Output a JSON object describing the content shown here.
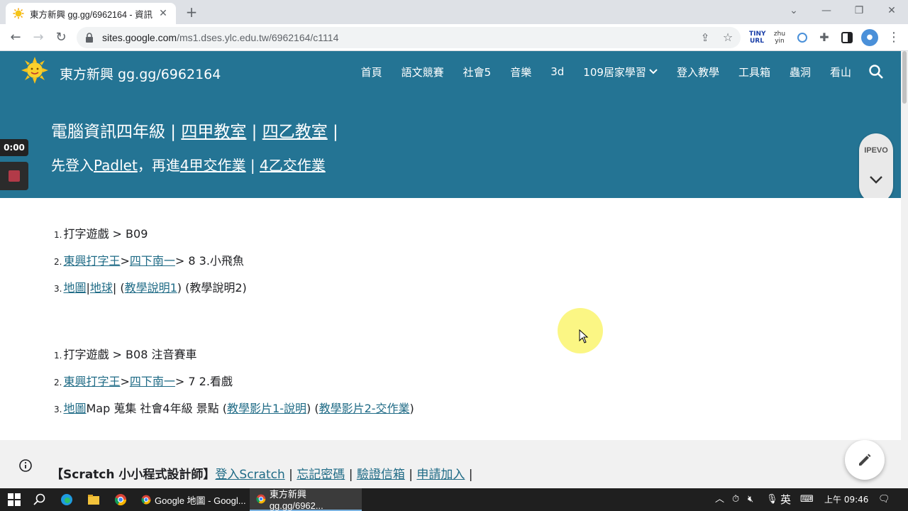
{
  "browser": {
    "tab_title": "東方新興 gg.gg/6962164 - 資訊",
    "url_host": "sites.google.com",
    "url_path": "/ms1.dses.ylc.edu.tw/6962164/c1114",
    "ext_tinyurl": "TINY URL",
    "ext_zhuyin": "zhu yin"
  },
  "site": {
    "title": "東方新興 gg.gg/6962164",
    "nav": [
      {
        "label": "首頁"
      },
      {
        "label": "語文競賽"
      },
      {
        "label": "社會5"
      },
      {
        "label": "音樂"
      },
      {
        "label": "3d"
      },
      {
        "label": "109居家學習"
      },
      {
        "label": "登入教學"
      },
      {
        "label": "工具箱"
      },
      {
        "label": "蟲洞"
      },
      {
        "label": "看山"
      }
    ]
  },
  "hero": {
    "line1_prefix": "電腦資訊四年級 | ",
    "link_class_a": "四甲教室",
    "sep1": " | ",
    "link_class_b": "四乙教室",
    "sep2": " |",
    "line2_prefix": "先登入",
    "link_padlet": "Padlet",
    "line2_mid": "，再進",
    "link_hw_a": "4甲交作業",
    "sep3": " | ",
    "link_hw_b": "4乙交作業"
  },
  "recorder": {
    "time": "0:00"
  },
  "ipevo": {
    "label": "IPEVO"
  },
  "list1": {
    "item1_num": "1.",
    "item1_text": "打字遊戲 > B09",
    "item2_num": "2.",
    "item2_link1": " 東興打字王 ",
    "item2_sep": "> ",
    "item2_link2": "四下南一",
    "item2_text": "  > 8 3.小飛魚",
    "item3_num": "3.",
    "item3_link1": "地圖 ",
    "item3_sep1": " | ",
    "item3_link2": "地球",
    "item3_sep2": " | (",
    "item3_link3": "教學說明1",
    "item3_text": " ) (教學說明2)"
  },
  "list2": {
    "item1_num": "1.",
    "item1_text": "打字遊戲 > B08 注音賽車",
    "item2_num": "2.",
    "item2_link1": " 東興打字王 ",
    "item2_sep": "> ",
    "item2_link2": "四下南一",
    "item2_text": "  > 7 2.看戲",
    "item3_num": "3.",
    "item3_link1": "地圖 ",
    "item3_text": " Map 蒐集 社會4年級 景點 (",
    "item3_link2": "教學影片1-說明",
    "item3_mid": ") (",
    "item3_link3": "教學影片2-交作業",
    "item3_end": ")"
  },
  "footer": {
    "bold_text": "【Scratch 小小程式設計師】",
    "link1": "登入Scratch",
    "sep": " | ",
    "link2": "忘記密碼",
    "link3": "驗證信箱",
    "link4": "申請加入",
    "end": " |"
  },
  "taskbar": {
    "app1": "Google 地圖 - Googl...",
    "app2": "東方新興 gg.gg/6962...",
    "ime": "英",
    "time": "上午 09:46"
  }
}
